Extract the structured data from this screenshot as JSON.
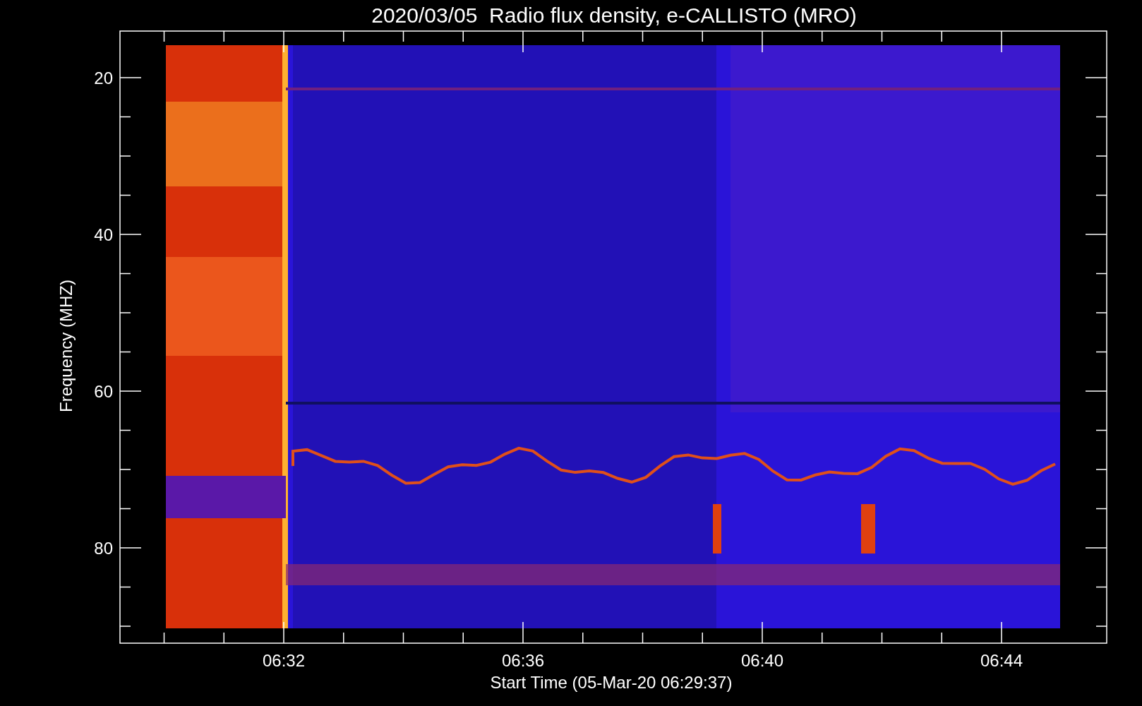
{
  "title": "2020/03/05  Radio flux density, e-CALLISTO (MRO)",
  "y_axis": {
    "label": "Frequency (MHZ)",
    "ticks": [
      "20",
      "40",
      "60",
      "80"
    ]
  },
  "x_axis": {
    "label": "Start Time (05-Mar-20 06:29:37)",
    "ticks": [
      "06:32",
      "06:36",
      "06:40",
      "06:44"
    ]
  }
}
